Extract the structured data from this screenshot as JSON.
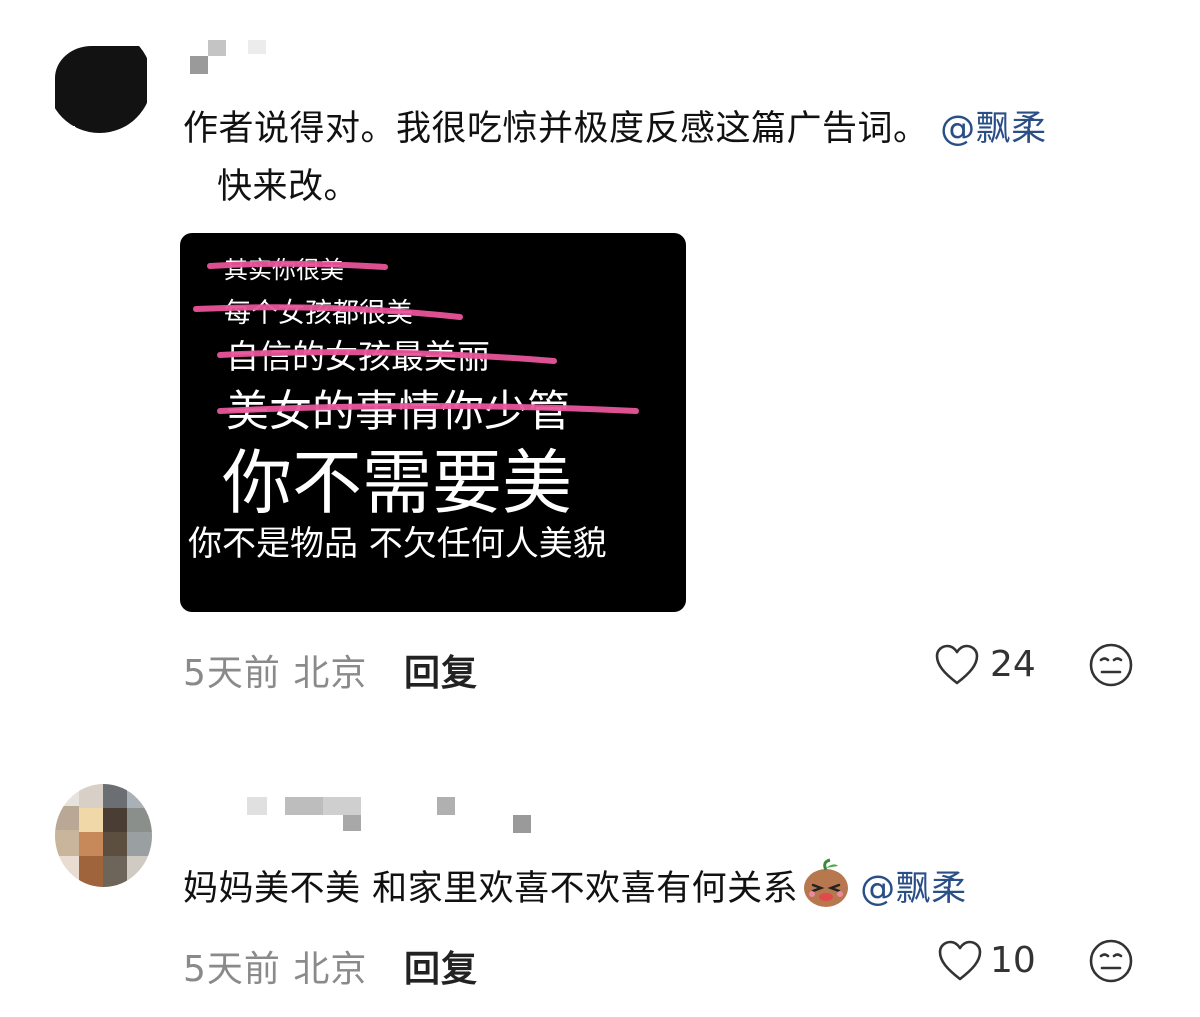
{
  "comments": [
    {
      "text_before": "作者说得对。我很吃惊并极度反感这篇广告词。",
      "mention_1": "@飘柔",
      "text_after": "快来改。",
      "image_lines": {
        "line1": "其实你很美",
        "line2": "每个女孩都很美",
        "line3": "自信的女孩最美丽",
        "line4": "美女的事情你少管",
        "line5": "你不需要美",
        "line6": "你不是物品 不欠任何人美貌"
      },
      "time": "5天前",
      "location": "北京",
      "reply_label": "回复",
      "likes": "24"
    },
    {
      "text": "妈妈美不美 和家里欢喜不欢喜有何关系",
      "mention": "@飘柔",
      "time": "5天前",
      "location": "北京",
      "reply_label": "回复",
      "likes": "10"
    }
  ],
  "icons": {
    "like": "heart-outline-icon",
    "emoji": "neutral-face-icon",
    "inline_emoji": "smirking-bean-emoji"
  },
  "colors": {
    "mention": "#2a4e86",
    "strike": "#e8559a",
    "meta": "#8a8a8a"
  }
}
